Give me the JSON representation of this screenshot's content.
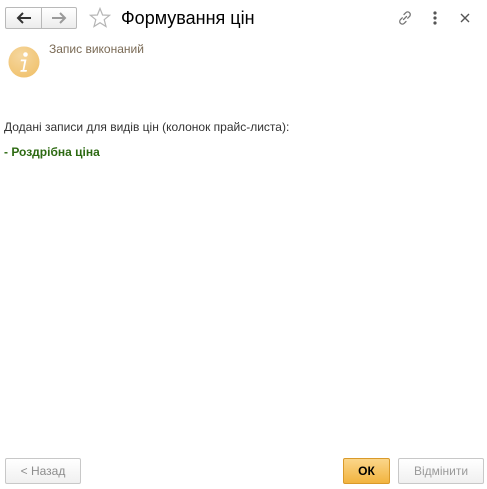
{
  "window": {
    "title": "Формування цін",
    "icons": {
      "back": "arrow-left-icon",
      "forward": "arrow-right-icon",
      "favorite": "star-icon",
      "link": "link-icon",
      "more": "more-vertical-icon",
      "close": "close-icon"
    }
  },
  "notice": {
    "icon": "info-icon",
    "label": "Запис виконаний"
  },
  "content": {
    "message": "Додані записи для видів цін (колонок прайс-листа):",
    "items": [
      "- Роздрібна ціна"
    ]
  },
  "footer": {
    "back_label": "< Назад",
    "ok_label": "ОК",
    "cancel_label": "Відмінити"
  },
  "colors": {
    "accent_button": "#f2b43f",
    "item_text": "#2d6a12",
    "label_text": "#7a6a55",
    "info_icon": "#f0c16b"
  }
}
